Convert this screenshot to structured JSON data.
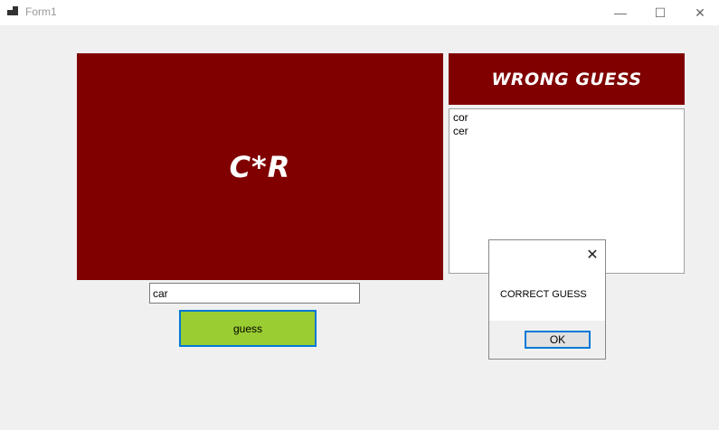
{
  "window": {
    "title": "Form1",
    "minimize_glyph": "—",
    "maximize_glyph": "☐",
    "close_glyph": "✕"
  },
  "game": {
    "masked_word": "C*R",
    "wrong_guess_title": "WRONG GUESS",
    "wrong_guesses": [
      "cor",
      "cer"
    ],
    "guess_input_value": "car",
    "guess_button_label": "guess"
  },
  "colors": {
    "panel": "#800000",
    "guess_button": "#9acd32",
    "focus_border": "#0078d7"
  },
  "dialog": {
    "message": "CORRECT GUESS",
    "ok_label": "OK",
    "close_glyph": "✕"
  },
  "icons": {
    "app": "app-icon",
    "minimize": "minimize-icon",
    "maximize": "maximize-icon",
    "close": "close-icon"
  }
}
